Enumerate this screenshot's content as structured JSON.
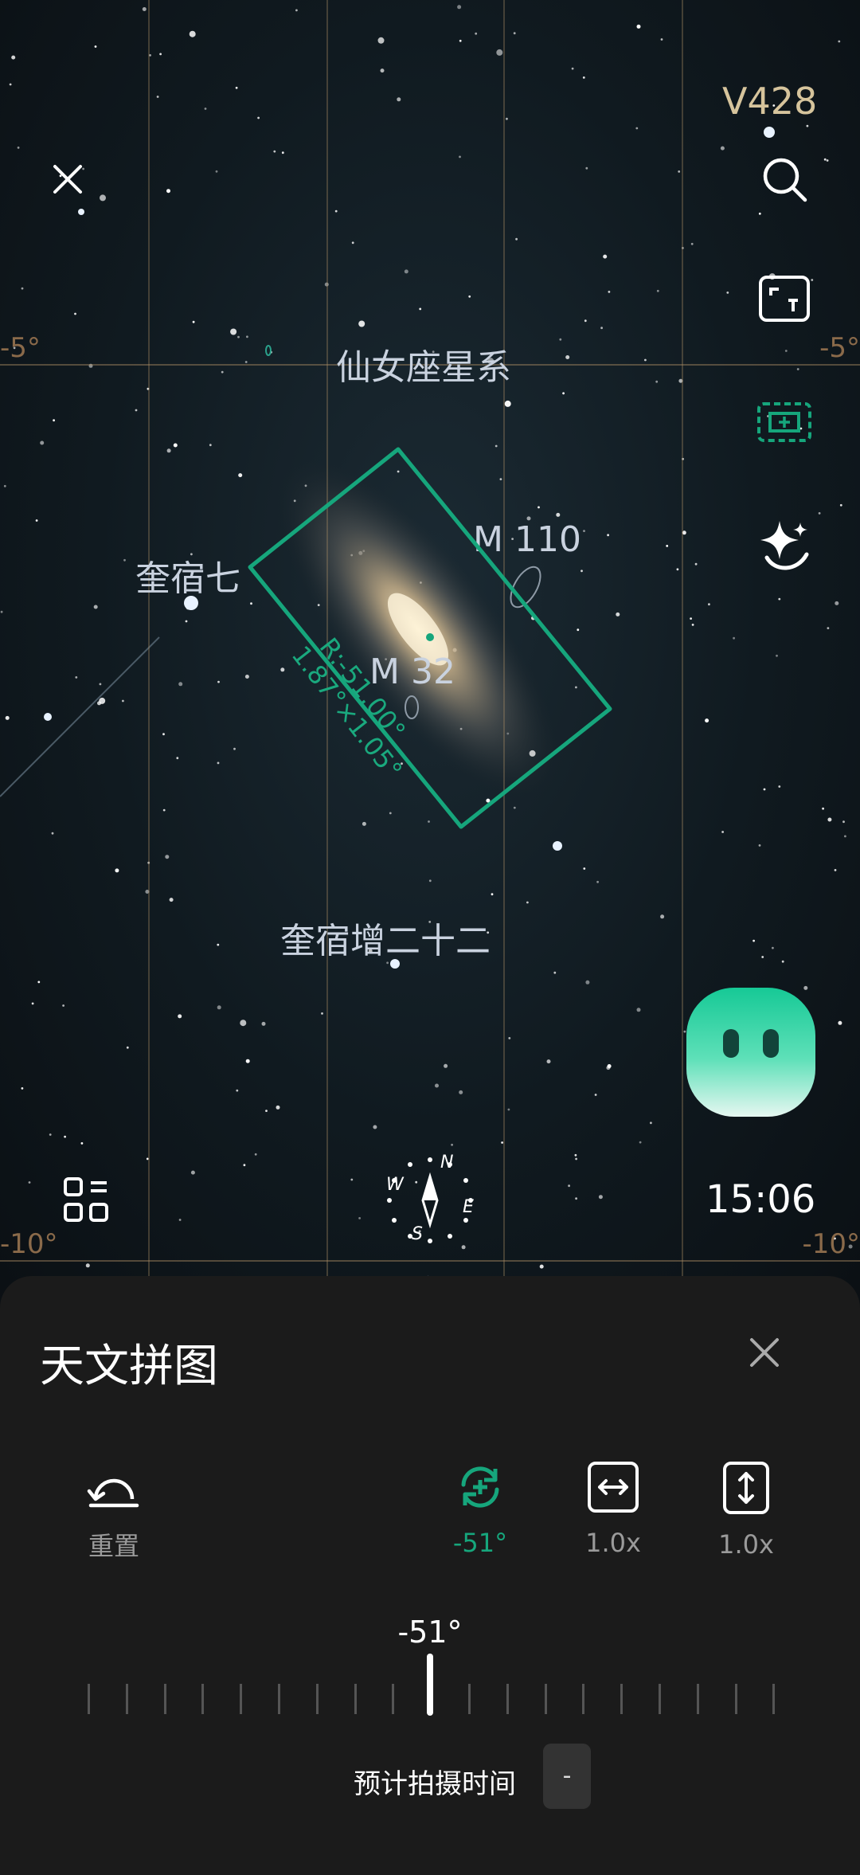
{
  "sky": {
    "grid_labels": {
      "left_top": "-5°",
      "right_top": "-5°",
      "left_bottom": "-10°",
      "right_bottom": "-10°"
    },
    "variable_star": "V428",
    "galaxy_name": "仙女座星系",
    "objects": {
      "m110": "M 110",
      "m32": "M 32",
      "star_left": "奎宿七",
      "star_bottom": "奎宿增二十二"
    },
    "frame": {
      "rotation_label": "R:-51.00°",
      "size_label": "1.87°×1.05°"
    },
    "compass": {
      "n": "N",
      "s": "S",
      "e": "E",
      "w": "W"
    },
    "time": "15:06"
  },
  "icons": {
    "close": "close-icon",
    "search": "search-icon",
    "fov": "fov-icon",
    "mosaic": "mosaic-icon",
    "ai_star": "sparkle-icon",
    "menu": "grid-menu-icon",
    "compass": "compass-icon",
    "assistant": "assistant-bubble-icon"
  },
  "panel": {
    "title": "天文拼图",
    "tools": {
      "reset_label": "重置",
      "rotate_value": "-51°",
      "width_scale": "1.0x",
      "height_scale": "1.0x"
    },
    "dial_value": "-51°",
    "estimate_label": "预计拍摄时间",
    "estimate_value": "-"
  },
  "colors": {
    "accent": "#16a67c",
    "panel_bg": "#1b1b1b",
    "label_gray": "#9a9a9a"
  }
}
